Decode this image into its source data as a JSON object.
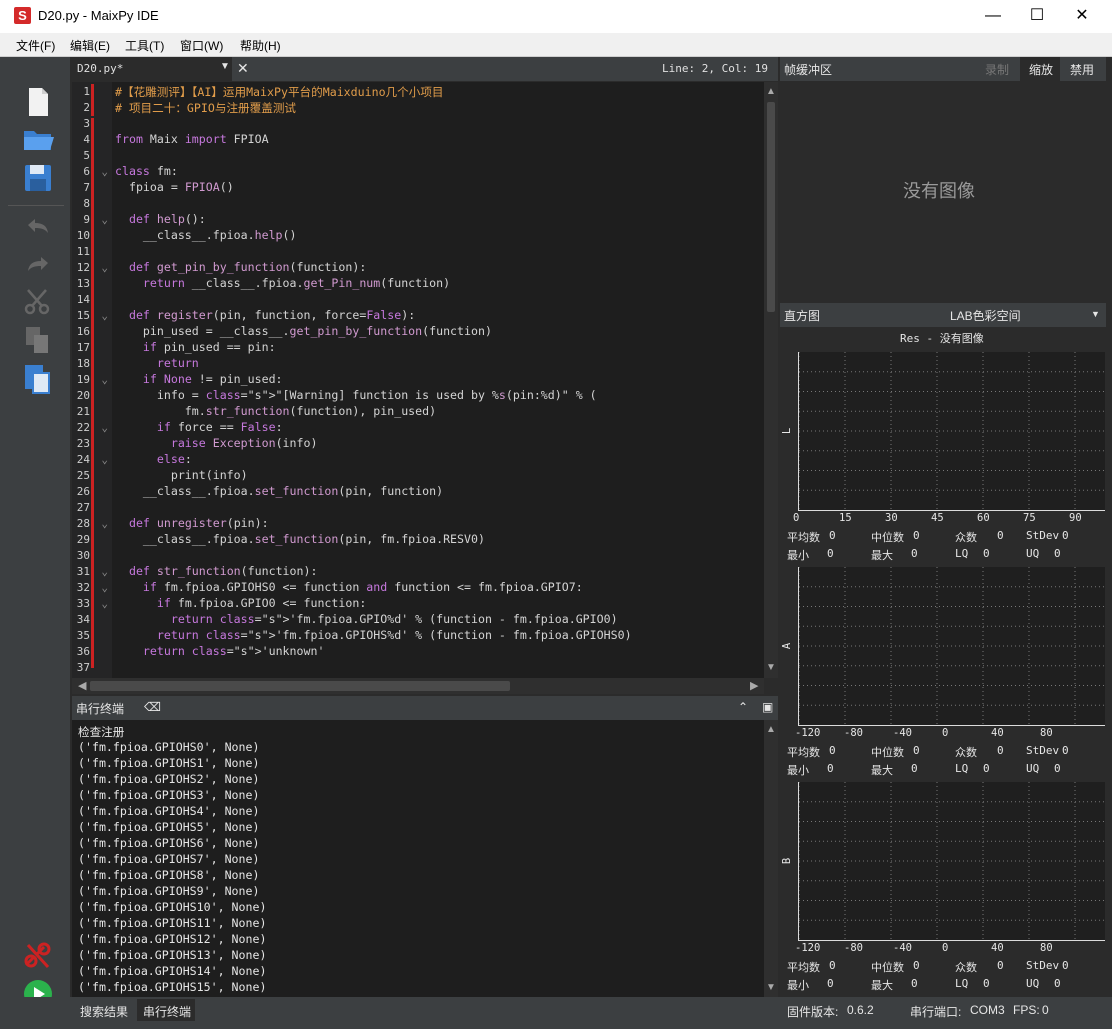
{
  "window": {
    "title": "D20.py - MaixPy IDE"
  },
  "menu": [
    "文件(F)",
    "编辑(E)",
    "工具(T)",
    "窗口(W)",
    "帮助(H)"
  ],
  "editor": {
    "tab_label": "D20.py*",
    "cursor_pos": "Line: 2, Col: 19",
    "line_numbers": [
      "1",
      "2",
      "3",
      "4",
      "5",
      "6",
      "7",
      "8",
      "9",
      "10",
      "11",
      "12",
      "13",
      "14",
      "15",
      "16",
      "17",
      "18",
      "19",
      "20",
      "21",
      "22",
      "23",
      "24",
      "25",
      "26",
      "27",
      "28",
      "29",
      "30",
      "31",
      "32",
      "33",
      "34",
      "35",
      "36",
      "37"
    ],
    "lines": [
      "#【花雕测评】【AI】运用MaixPy平台的Maixduino几个小项目",
      "# 项目二十：GPIO与注册覆盖测试",
      "",
      "from Maix import FPIOA",
      "",
      "class fm:",
      "  fpioa = FPIOA()",
      "",
      "  def help():",
      "    __class__.fpioa.help()",
      "",
      "  def get_pin_by_function(function):",
      "    return __class__.fpioa.get_Pin_num(function)",
      "",
      "  def register(pin, function, force=False):",
      "    pin_used = __class__.get_pin_by_function(function)",
      "    if pin_used == pin:",
      "      return",
      "    if None != pin_used:",
      "      info = \"[Warning] function is used by %s(pin:%d)\" % (",
      "          fm.str_function(function), pin_used)",
      "      if force == False:",
      "        raise Exception(info)",
      "      else:",
      "        print(info)",
      "    __class__.fpioa.set_function(pin, function)",
      "",
      "  def unregister(pin):",
      "    __class__.fpioa.set_function(pin, fm.fpioa.RESV0)",
      "",
      "  def str_function(function):",
      "    if fm.fpioa.GPIOHS0 <= function and function <= fm.fpioa.GPIO7:",
      "      if fm.fpioa.GPIO0 <= function:",
      "        return 'fm.fpioa.GPIO%d' % (function - fm.fpioa.GPIO0)",
      "      return 'fm.fpioa.GPIOHS%d' % (function - fm.fpioa.GPIOHS0)",
      "    return 'unknown'",
      ""
    ]
  },
  "terminal": {
    "title": "串行终端",
    "lines": [
      "检查注册",
      "('fm.fpioa.GPIOHS0', None)",
      "('fm.fpioa.GPIOHS1', None)",
      "('fm.fpioa.GPIOHS2', None)",
      "('fm.fpioa.GPIOHS3', None)",
      "('fm.fpioa.GPIOHS4', None)",
      "('fm.fpioa.GPIOHS5', None)",
      "('fm.fpioa.GPIOHS6', None)",
      "('fm.fpioa.GPIOHS7', None)",
      "('fm.fpioa.GPIOHS8', None)",
      "('fm.fpioa.GPIOHS9', None)",
      "('fm.fpioa.GPIOHS10', None)",
      "('fm.fpioa.GPIOHS11', None)",
      "('fm.fpioa.GPIOHS12', None)",
      "('fm.fpioa.GPIOHS13', None)",
      "('fm.fpioa.GPIOHS14', None)",
      "('fm.fpioa.GPIOHS15', None)"
    ]
  },
  "bottom_tabs": [
    "搜索结果",
    "串行终端"
  ],
  "status": {
    "firmware_label": "固件版本:",
    "firmware": "0.6.2",
    "port_label": "串行端口:",
    "port": "COM3",
    "fps_label": "FPS:",
    "fps": "0"
  },
  "framebuffer": {
    "title": "帧缓冲区",
    "record": "录制",
    "zoom": "缩放",
    "disable": "禁用",
    "no_image": "没有图像"
  },
  "histogram": {
    "title": "直方图",
    "color_space": "LAB色彩空间",
    "res": "Res - 没有图像",
    "graphs": [
      {
        "axis": "L",
        "ticks": [
          "0",
          "15",
          "30",
          "45",
          "60",
          "75",
          "90"
        ]
      },
      {
        "axis": "A",
        "ticks": [
          "-120",
          "-80",
          "-40",
          "0",
          "40",
          "80"
        ]
      },
      {
        "axis": "B",
        "ticks": [
          "-120",
          "-80",
          "-40",
          "0",
          "40",
          "80"
        ]
      }
    ],
    "stat_labels": {
      "mean": "平均数",
      "median": "中位数",
      "mode": "众数",
      "stdev": "StDev",
      "min": "最小",
      "max": "最大",
      "lq": "LQ",
      "uq": "UQ"
    },
    "stat_value": "0"
  },
  "colors": {
    "accent": "#4a8fd9",
    "error_mark": "#cc2222",
    "run": "#2bb24c"
  }
}
